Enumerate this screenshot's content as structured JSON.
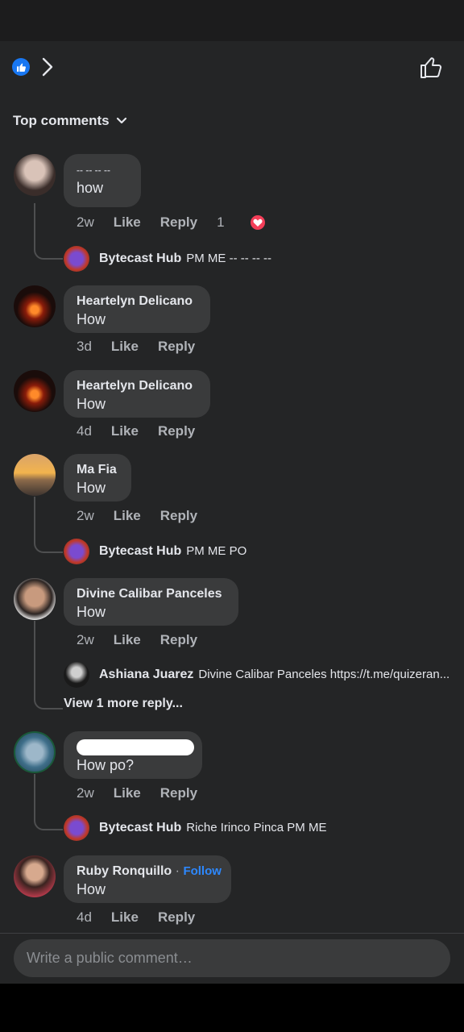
{
  "sort": {
    "label": "Top comments"
  },
  "comments": [
    {
      "name": "-- -- -- --",
      "text": "how",
      "time": "2w",
      "like": "Like",
      "reply": "Reply",
      "reactions": "1",
      "replies": [
        {
          "name": "Bytecast Hub",
          "text": "PM ME -- -- -- --"
        }
      ]
    },
    {
      "name": "Heartelyn Delicano",
      "text": "How",
      "time": "3d",
      "like": "Like",
      "reply": "Reply"
    },
    {
      "name": "Heartelyn Delicano",
      "text": "How",
      "time": "4d",
      "like": "Like",
      "reply": "Reply"
    },
    {
      "name": "Ma Fia",
      "text": "How",
      "time": "2w",
      "like": "Like",
      "reply": "Reply",
      "replies": [
        {
          "name": "Bytecast Hub",
          "text": "PM ME PO"
        }
      ]
    },
    {
      "name": "Divine Calibar Panceles",
      "text": "How",
      "time": "2w",
      "like": "Like",
      "reply": "Reply",
      "replies": [
        {
          "name": "Ashiana Juarez",
          "text": "Divine Calibar Panceles https://t.me/quizeran..."
        }
      ],
      "more_replies": "View 1 more reply..."
    },
    {
      "name": "",
      "text": "How po?",
      "time": "2w",
      "like": "Like",
      "reply": "Reply",
      "replies": [
        {
          "name": "Bytecast Hub",
          "text": "Riche Irinco Pinca PM ME"
        }
      ]
    },
    {
      "name": "Ruby Ronquillo",
      "follow": "Follow",
      "separator": "·",
      "text": "How",
      "time": "4d",
      "like": "Like",
      "reply": "Reply"
    }
  ],
  "composer": {
    "placeholder": "Write a public comment…"
  },
  "colors": {
    "accent": "#1877f2",
    "heart": "#f33e58",
    "bubble": "#3a3b3c",
    "background": "#242526"
  }
}
